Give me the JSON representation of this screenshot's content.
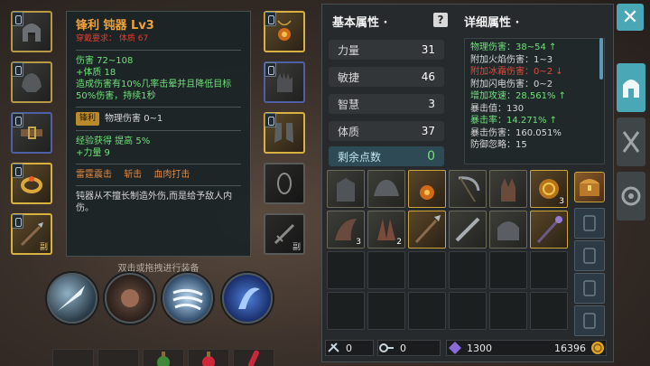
{
  "tooltip": {
    "title": "锋利 钝器 Lv3",
    "requirement": "穿戴要求：   体质 67",
    "stats": [
      "伤害  72~108",
      "+体质 18",
      "造成伤害有10%几率击晕并且降低目标50%伤害，持续1秒"
    ],
    "affix_badge": "锋利",
    "affix_text": "物理伤害 0~1",
    "bonus": [
      "经验获得 提高 5%",
      "+力量 9"
    ],
    "skills": [
      "雷霆震击",
      "斩击",
      "血肉打击"
    ],
    "description": "钝器从不擅长制造外伤,而是给予敌人内伤。"
  },
  "hint": "双击或拖拽进行装备",
  "equip_corner_label": "副",
  "basic": {
    "title": "基本属性 ·",
    "stats": [
      {
        "name": "力量",
        "value": "31"
      },
      {
        "name": "敏捷",
        "value": "46"
      },
      {
        "name": "智慧",
        "value": "3"
      },
      {
        "name": "体质",
        "value": "37"
      }
    ],
    "remaining_label": "剩余点数",
    "remaining_value": "0"
  },
  "detail": {
    "title": "详细属性 ·",
    "lines": [
      {
        "text": "物理伤害：38~54 ↑",
        "color": "#6fe07a"
      },
      {
        "text": "附加火焰伤害：1~3",
        "color": "#d8d8d8"
      },
      {
        "text": "附加冰霜伤害：0~2 ↓",
        "color": "#e24a3a"
      },
      {
        "text": "附加闪电伤害：0~2",
        "color": "#d8d8d8"
      },
      {
        "text": "增加攻速：28.561% ↑",
        "color": "#6fe07a"
      },
      {
        "text": "暴击值：130",
        "color": "#d8d8d8"
      },
      {
        "text": "暴击率：14.271% ↑",
        "color": "#6fe07a"
      },
      {
        "text": "暴击伤害：160.051%",
        "color": "#d8d8d8"
      },
      {
        "text": "防御忽略：15",
        "color": "#d8d8d8"
      }
    ]
  },
  "inventory": {
    "counts": [
      "3",
      "3",
      "2"
    ]
  },
  "currency": {
    "scroll": "0",
    "key": "0",
    "crystal": "1300",
    "gold": "16396"
  },
  "icons": {
    "close": "close-icon",
    "help": "question-icon",
    "helmet": "helmet-icon",
    "weapons": "crossed-swords-icon",
    "settings": "gear-icon"
  }
}
